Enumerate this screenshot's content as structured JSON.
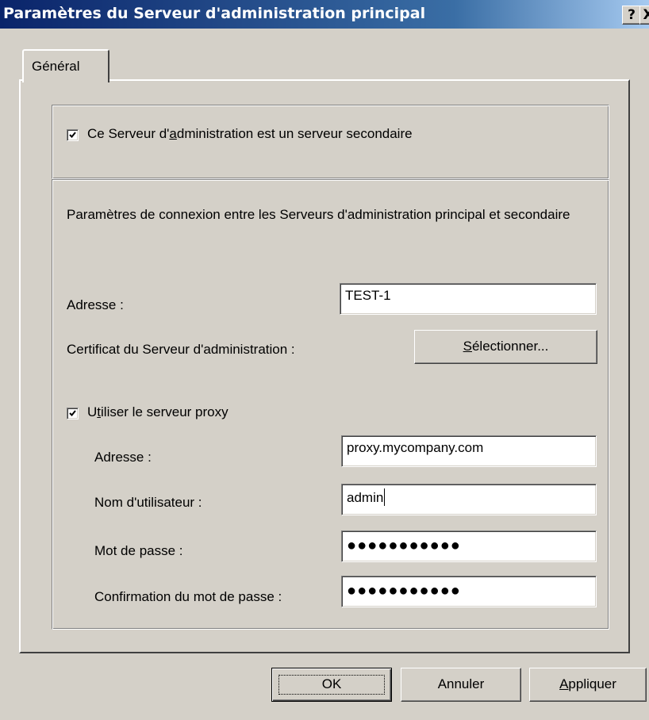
{
  "window": {
    "title": "Paramètres du Serveur d'administration principal",
    "help_button": "?",
    "close_button": "X"
  },
  "tabs": [
    {
      "label": "Général",
      "selected": true
    }
  ],
  "secondary_server": {
    "checked": true,
    "label_pre": "Ce Serveur d'",
    "label_accel": "a",
    "label_post": "dministration est un serveur secondaire"
  },
  "connection": {
    "description": "Paramètres de connexion entre les Serveurs d'administration principal et secondaire",
    "address_label": "Adresse :",
    "address_value": "TEST-1",
    "certificate_label": "Certificat du Serveur d'administration :",
    "select_button_accel": "S",
    "select_button_rest": "électionner..."
  },
  "proxy": {
    "checked": true,
    "label_pre": "U",
    "label_accel": "t",
    "label_post": "iliser le serveur proxy",
    "address_label": "Adresse :",
    "address_value": "proxy.mycompany.com",
    "username_label": "Nom d'utilisateur :",
    "username_value": "admin",
    "password_label": "Mot de passe :",
    "password_value": "●●●●●●●●●●●",
    "confirm_label": "Confirmation du mot de passe :",
    "confirm_value": "●●●●●●●●●●●"
  },
  "buttons": {
    "ok": "OK",
    "cancel": "Annuler",
    "apply_accel": "A",
    "apply_rest": "ppliquer"
  }
}
